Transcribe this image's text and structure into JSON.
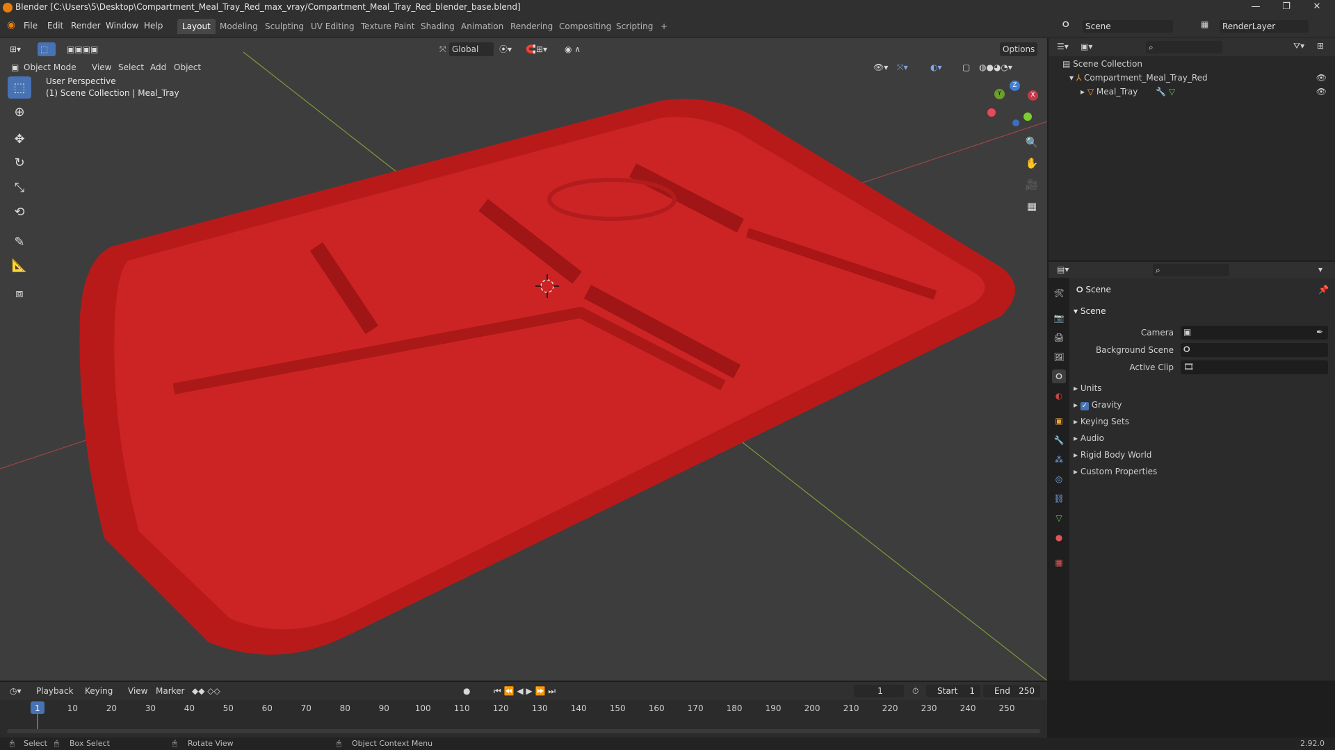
{
  "window": {
    "title": "Blender [C:\\Users\\5\\Desktop\\Compartment_Meal_Tray_Red_max_vray/Compartment_Meal_Tray_Red_blender_base.blend]",
    "controls": [
      "—",
      "❐",
      "✕"
    ]
  },
  "menus": [
    "File",
    "Edit",
    "Render",
    "Window",
    "Help"
  ],
  "workspaces": [
    "Layout",
    "Modeling",
    "Sculpting",
    "UV Editing",
    "Texture Paint",
    "Shading",
    "Animation",
    "Rendering",
    "Compositing",
    "Scripting",
    "+"
  ],
  "active_workspace": "Layout",
  "scene_selector": "Scene",
  "renderlayer_selector": "RenderLayer",
  "viewport": {
    "mode": "Object Mode",
    "menus": [
      "View",
      "Select",
      "Add",
      "Object"
    ],
    "transform_orientation": "Global",
    "options": "Options",
    "overlay_line1": "User Perspective",
    "overlay_line2": "(1) Scene Collection | Meal_Tray",
    "gizmo": {
      "x": "X",
      "y": "Y",
      "z": "Z"
    }
  },
  "outliner": {
    "root": "Scene Collection",
    "collection": "Compartment_Meal_Tray_Red",
    "object": "Meal_Tray"
  },
  "properties": {
    "header": "Scene",
    "panel": "Scene",
    "fields": [
      {
        "label": "Camera",
        "value": ""
      },
      {
        "label": "Background Scene",
        "value": ""
      },
      {
        "label": "Active Clip",
        "value": ""
      }
    ],
    "sections": [
      "Units",
      "Gravity",
      "Keying Sets",
      "Audio",
      "Rigid Body World",
      "Custom Properties"
    ],
    "gravity_checked": true
  },
  "timeline": {
    "menus": [
      "Playback",
      "Keying",
      "View",
      "Marker"
    ],
    "current_frame": "1",
    "start_label": "Start",
    "start": "1",
    "end_label": "End",
    "end": "250",
    "ticks": [
      "1",
      "10",
      "20",
      "30",
      "40",
      "50",
      "60",
      "70",
      "80",
      "90",
      "100",
      "110",
      "120",
      "130",
      "140",
      "150",
      "160",
      "170",
      "180",
      "190",
      "200",
      "210",
      "220",
      "230",
      "240",
      "250"
    ]
  },
  "statusbar": {
    "select": "Select",
    "box_select": "Box Select",
    "rotate_view": "Rotate View",
    "context_menu": "Object Context Menu",
    "version": "2.92.0"
  },
  "colors": {
    "accent": "#4772b3",
    "tray": "#c51f1f",
    "viewport_bg": "#3d3d3d"
  }
}
